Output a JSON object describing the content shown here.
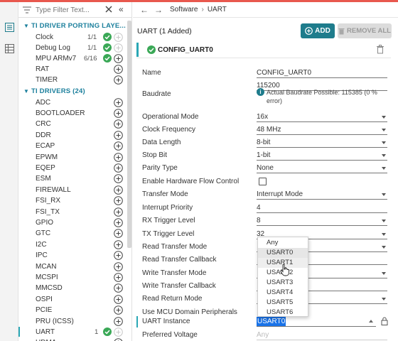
{
  "sidebar": {
    "filter_placeholder": "Type Filter Text...",
    "categories": [
      {
        "label": "TI DRIVER PORTING LAYE..."
      },
      {
        "label": "TI DRIVERS (24)"
      }
    ],
    "porting_items": [
      {
        "label": "Clock",
        "count": "1/1",
        "added": true
      },
      {
        "label": "Debug Log",
        "count": "1/1",
        "added": true
      },
      {
        "label": "MPU ARMv7",
        "count": "6/16",
        "added": true
      },
      {
        "label": "RAT",
        "count": "",
        "added": false
      },
      {
        "label": "TIMER",
        "count": "",
        "added": false
      }
    ],
    "driver_items": [
      {
        "label": "ADC",
        "count": "",
        "added": false
      },
      {
        "label": "BOOTLOADER",
        "count": "",
        "added": false
      },
      {
        "label": "CRC",
        "count": "",
        "added": false
      },
      {
        "label": "DDR",
        "count": "",
        "added": false
      },
      {
        "label": "ECAP",
        "count": "",
        "added": false
      },
      {
        "label": "EPWM",
        "count": "",
        "added": false
      },
      {
        "label": "EQEP",
        "count": "",
        "added": false
      },
      {
        "label": "ESM",
        "count": "",
        "added": false
      },
      {
        "label": "FIREWALL",
        "count": "",
        "added": false
      },
      {
        "label": "FSI_RX",
        "count": "",
        "added": false
      },
      {
        "label": "FSI_TX",
        "count": "",
        "added": false
      },
      {
        "label": "GPIO",
        "count": "",
        "added": false
      },
      {
        "label": "GTC",
        "count": "",
        "added": false
      },
      {
        "label": "I2C",
        "count": "",
        "added": false
      },
      {
        "label": "IPC",
        "count": "",
        "added": false
      },
      {
        "label": "MCAN",
        "count": "",
        "added": false
      },
      {
        "label": "MCSPI",
        "count": "",
        "added": false
      },
      {
        "label": "MMCSD",
        "count": "",
        "added": false
      },
      {
        "label": "OSPI",
        "count": "",
        "added": false
      },
      {
        "label": "PCIE",
        "count": "",
        "added": false
      },
      {
        "label": "PRU (ICSS)",
        "count": "",
        "added": false
      },
      {
        "label": "UART",
        "count": "1",
        "added": true
      },
      {
        "label": "UDMA",
        "count": "",
        "added": false
      }
    ]
  },
  "breadcrumb": {
    "items": [
      "Software",
      "UART"
    ]
  },
  "header": {
    "title": "UART (1 Added)",
    "add_label": "ADD",
    "remove_label": "REMOVE ALL"
  },
  "config": {
    "name": "CONFIG_UART0",
    "properties": [
      {
        "label": "Name",
        "value": "CONFIG_UART0",
        "type": "text"
      },
      {
        "label": "Baudrate",
        "value": "115200",
        "type": "text"
      },
      {
        "label": "Operational Mode",
        "value": "16x",
        "type": "select"
      },
      {
        "label": "Clock Frequency",
        "value": "48 MHz",
        "type": "select"
      },
      {
        "label": "Data Length",
        "value": "8-bit",
        "type": "select"
      },
      {
        "label": "Stop Bit",
        "value": "1-bit",
        "type": "select"
      },
      {
        "label": "Parity Type",
        "value": "None",
        "type": "select"
      },
      {
        "label": "Enable Hardware Flow Control",
        "value": "",
        "type": "checkbox"
      },
      {
        "label": "Transfer Mode",
        "value": "Interrupt Mode",
        "type": "select"
      },
      {
        "label": "Interrupt Priority",
        "value": "4",
        "type": "text"
      },
      {
        "label": "RX Trigger Level",
        "value": "8",
        "type": "select"
      },
      {
        "label": "TX Trigger Level",
        "value": "32",
        "type": "select"
      },
      {
        "label": "Read Transfer Mode",
        "value": "",
        "type": "select"
      },
      {
        "label": "Read Transfer Callback",
        "value": "",
        "type": "text"
      },
      {
        "label": "Write Transfer Mode",
        "value": "",
        "type": "select"
      },
      {
        "label": "Write Transfer Callback",
        "value": "",
        "type": "text"
      },
      {
        "label": "Read Return Mode",
        "value": "",
        "type": "select"
      },
      {
        "label": "Use MCU Domain Peripherals",
        "value": "",
        "type": "checkbox"
      }
    ],
    "baud_info": "Actual Baudrate Possible: 115385 (0 % error)",
    "instance_label": "UART Instance",
    "instance_value": "USART0",
    "preferred_voltage_label": "Preferred Voltage",
    "preferred_voltage_value": "Any"
  },
  "dropdown": {
    "options": [
      "Any",
      "USART0",
      "USART1",
      "USART2",
      "USART3",
      "USART4",
      "USART5",
      "USART6"
    ],
    "selected": "USART0",
    "hovered": "USART1"
  },
  "colors": {
    "accent": "#1e7c8c",
    "success": "#3aa856",
    "selection": "#1a73e8",
    "topline": "#e8584e"
  }
}
